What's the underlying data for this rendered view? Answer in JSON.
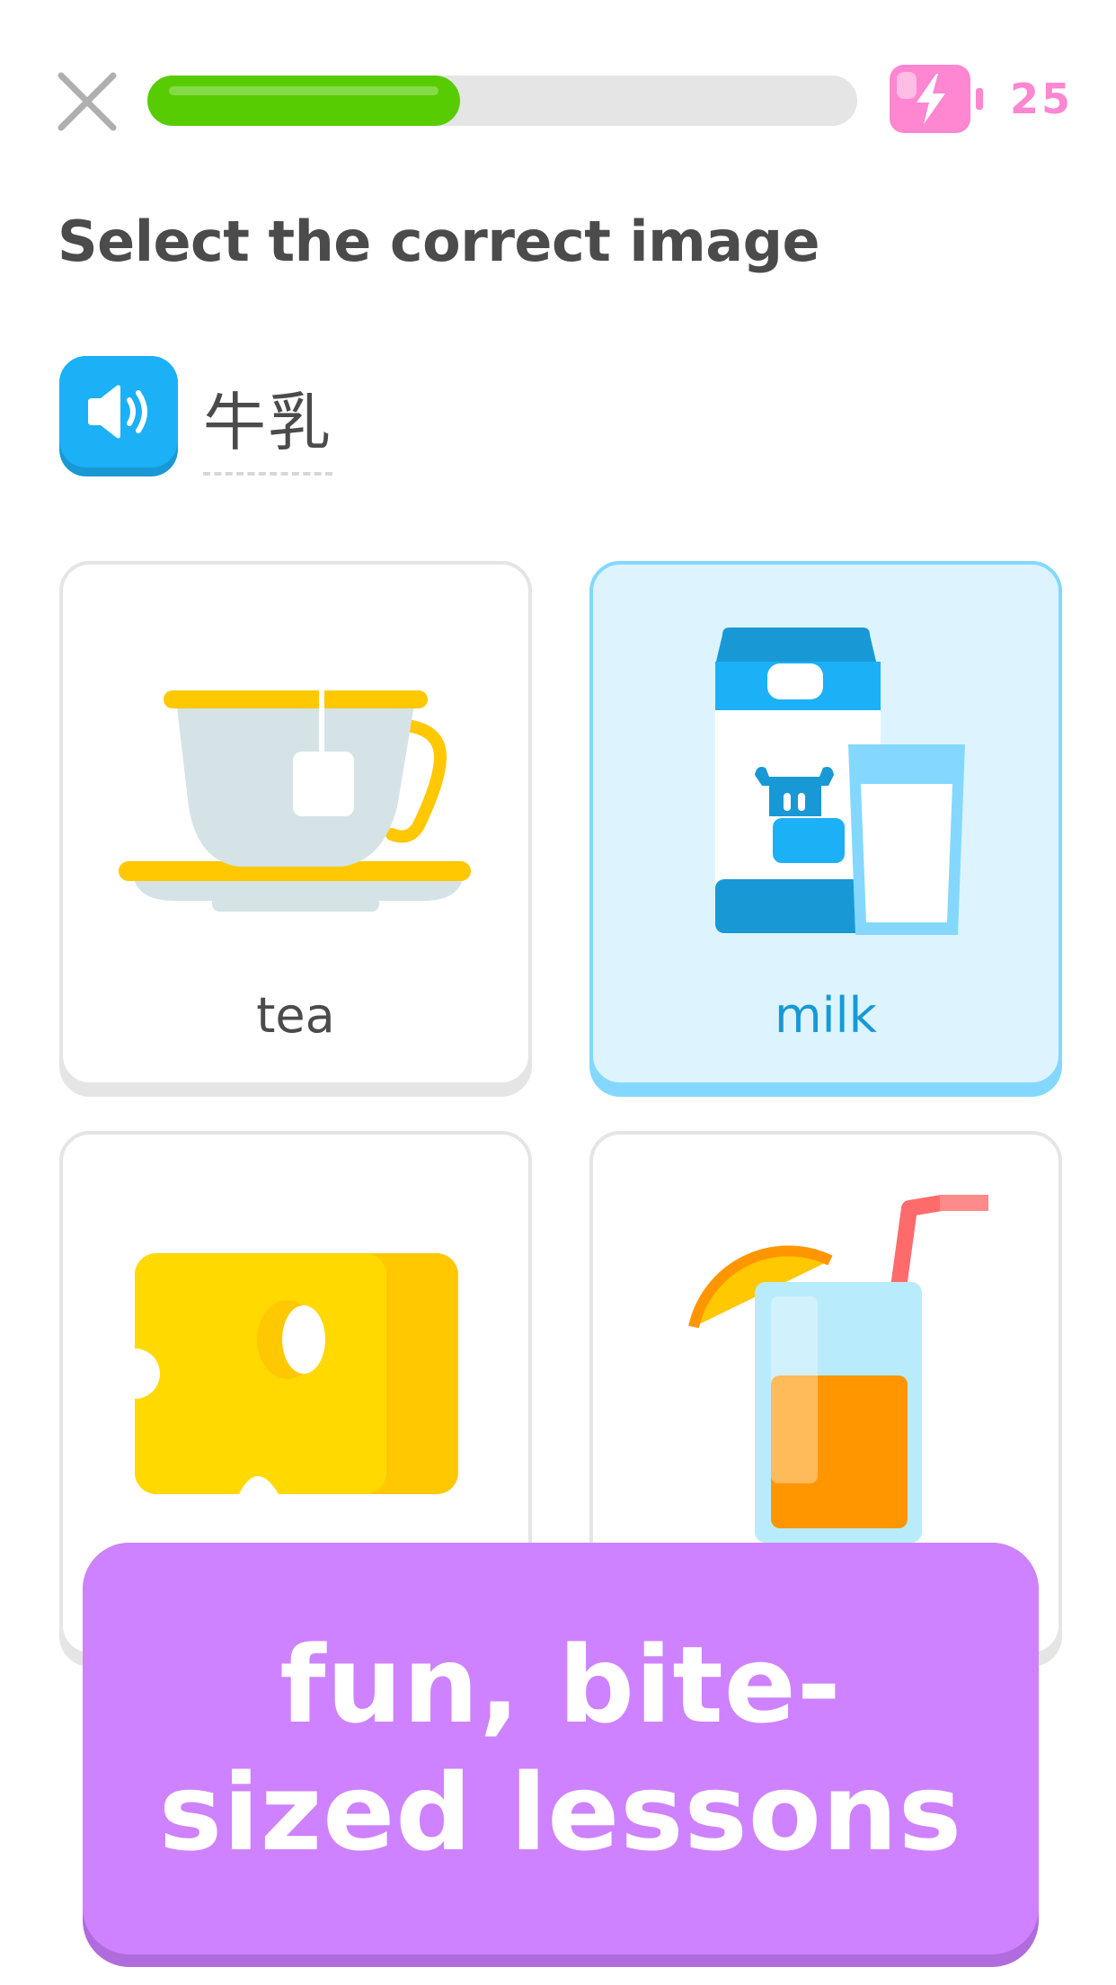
{
  "header": {
    "close_icon": "close-icon",
    "progress_percent": 44,
    "energy_icon": "energy-battery-icon",
    "energy_count": "25"
  },
  "title": "Select the correct image",
  "prompt": {
    "speaker_icon": "speaker-icon",
    "word": "牛乳"
  },
  "options": [
    {
      "id": "tea",
      "label": "tea",
      "icon": "teacup-icon",
      "selected": false
    },
    {
      "id": "milk",
      "label": "milk",
      "icon": "milk-carton-icon",
      "selected": true
    },
    {
      "id": "cheese",
      "label": "",
      "icon": "cheese-icon",
      "selected": false
    },
    {
      "id": "juice",
      "label": "",
      "icon": "orange-juice-icon",
      "selected": false
    }
  ],
  "banner": {
    "text": "fun, bite-sized lessons"
  },
  "colors": {
    "progress": "#58cc02",
    "energy": "#ff86d0",
    "speaker": "#1cb0f6",
    "selected_border": "#84d8ff",
    "selected_fill": "#ddf4ff",
    "banner": "#ce82ff"
  }
}
